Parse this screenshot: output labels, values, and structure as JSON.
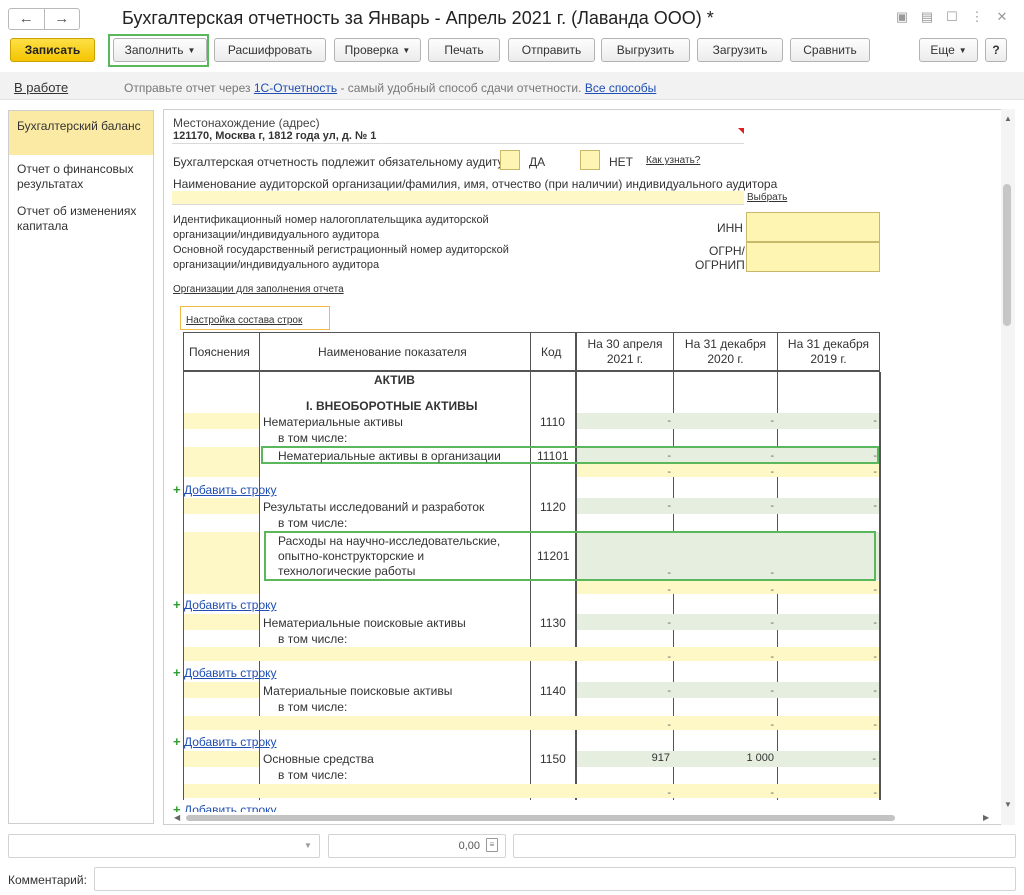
{
  "window": {
    "title": "Бухгалтерская отчетность за Январь - Апрель 2021 г. (Лаванда ООО) *",
    "icons": [
      "save-icon",
      "print-icon",
      "preview-icon",
      "more-icon",
      "close-icon"
    ]
  },
  "toolbar": {
    "save": "Записать",
    "fill": "Заполнить",
    "decode": "Расшифровать",
    "check": "Проверка",
    "print": "Печать",
    "send": "Отправить",
    "export": "Выгрузить",
    "import": "Загрузить",
    "compare": "Сравнить",
    "more": "Еще",
    "help": "?"
  },
  "infobar": {
    "status": "В работе",
    "text_before": "Отправьте отчет через",
    "link1": "1С-Отчетность",
    "text_after": "- самый удобный способ сдачи отчетности.",
    "link2": "Все способы"
  },
  "sidebar": {
    "items": [
      {
        "label": "Бухгалтерский баланс"
      },
      {
        "label": "Отчет о финансовых результатах"
      },
      {
        "label": "Отчет об изменениях капитала"
      }
    ]
  },
  "header": {
    "location_label": "Местонахождение (адрес)",
    "address": "121170, Москва г, 1812 года ул, д. № 1",
    "audit_label": "Бухгалтерская отчетность подлежит обязательному аудиту",
    "yes": "ДА",
    "no": "НЕТ",
    "how_link": "Как узнать?",
    "auditor_label": "Наименование аудиторской организации/фамилия, имя, отчество (при наличии) индивидуального аудитора",
    "choose_link": "Выбрать",
    "inn_desc": "Идентификационный номер налогоплательщика аудиторской организации/индивидуального аудитора",
    "inn_label": "ИНН",
    "ogrn_desc": "Основной государственный регистрационный номер аудиторской организации/индивидуального аудитора",
    "ogrn_label1": "ОГРН/",
    "ogrn_label2": "ОГРНИП",
    "orgs_link": "Организации для заполнения отчета",
    "rows_link": "Настройка состава строк"
  },
  "table": {
    "col_notes": "Пояснения",
    "col_name": "Наименование показателя",
    "col_code": "Код",
    "col_d1": "На 30 апреля 2021 г.",
    "col_d2": "На 31 декабря 2020 г.",
    "col_d3": "На 31 декабря 2019 г.",
    "section": "АКТИВ",
    "subsection": "I. ВНЕОБОРОТНЫЕ АКТИВЫ",
    "including": "в том числе:",
    "add_row": "Добавить строку",
    "rows": [
      {
        "name": "Нематериальные активы",
        "code": "1110"
      },
      {
        "name": "Нематериальные активы в организации",
        "code": "11101"
      },
      {
        "name": "Результаты исследований и разработок",
        "code": "1120"
      },
      {
        "name1": "Расходы на научно-исследовательские,",
        "name2": "опытно-конструкторские и",
        "name3": "технологические работы",
        "code": "11201"
      },
      {
        "name": "Нематериальные поисковые активы",
        "code": "1130"
      },
      {
        "name": "Материальные поисковые активы",
        "code": "1140"
      },
      {
        "name": "Основные средства",
        "code": "1150",
        "v1": "917",
        "v2": "1 000"
      }
    ],
    "dash": "-"
  },
  "footer": {
    "amount": "0,00",
    "comment_label": "Комментарий:"
  }
}
